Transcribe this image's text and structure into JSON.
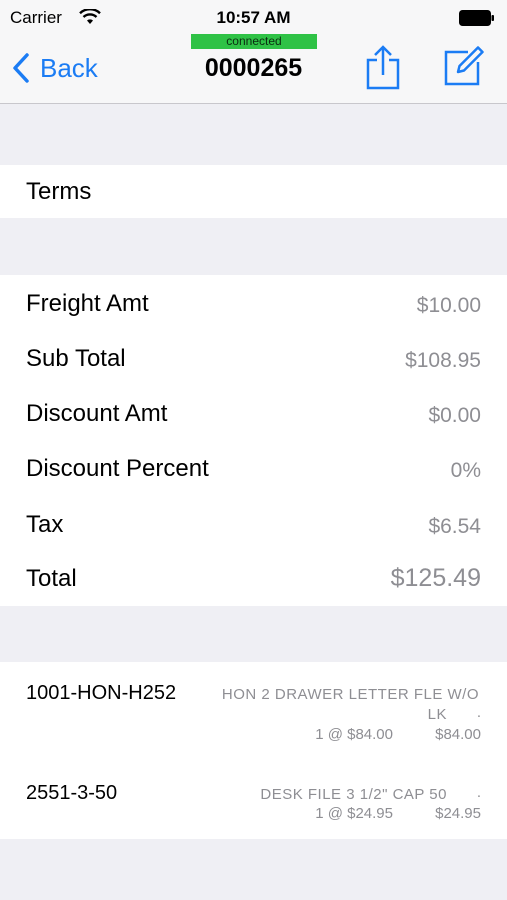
{
  "status_bar": {
    "carrier": "Carrier",
    "time": "10:57 AM"
  },
  "nav": {
    "back_label": "Back",
    "connection_status": "connected",
    "title": "0000265",
    "accent_color": "#1b7cf4",
    "connected_color": "#2fc246"
  },
  "terms": {
    "label": "Terms"
  },
  "totals": {
    "freight_label": "Freight Amt",
    "freight_value": "$10.00",
    "subtotal_label": "Sub Total",
    "subtotal_value": "$108.95",
    "discount_amt_label": "Discount Amt",
    "discount_amt_value": "$0.00",
    "discount_pct_label": "Discount Percent",
    "discount_pct_value": "0%",
    "tax_label": "Tax",
    "tax_value": "$6.54",
    "total_label": "Total",
    "total_value": "$125.49"
  },
  "line_items": [
    {
      "code": "1001-HON-H252",
      "desc_line1": "HON 2 DRAWER LETTER FLE W/O",
      "desc_line2": "LK",
      "qty_price": "1 @ $84.00",
      "amount": "$84.00"
    },
    {
      "code": "2551-3-50",
      "desc_line1": "DESK FILE 3 1/2\" CAP 50",
      "qty_price": "1 @ $24.95",
      "amount": "$24.95"
    }
  ],
  "icons": {
    "wifi": "wifi-icon",
    "battery": "battery-icon",
    "back": "chevron-left-icon",
    "share": "share-icon",
    "compose": "compose-icon"
  }
}
